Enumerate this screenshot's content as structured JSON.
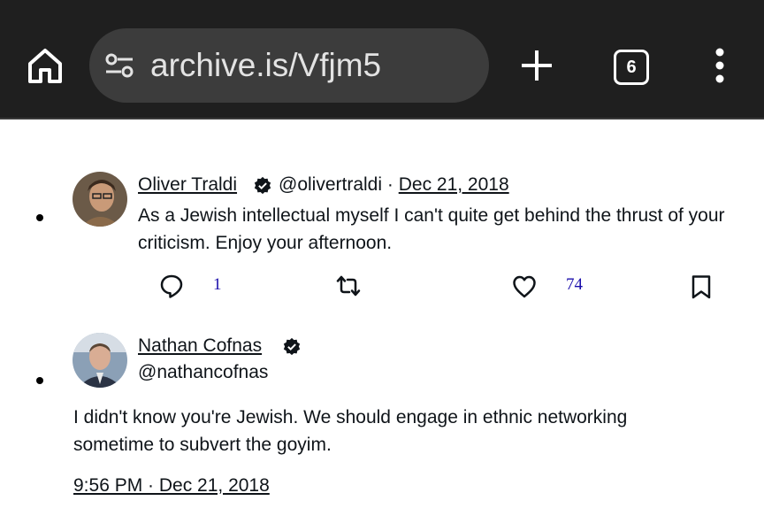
{
  "browser": {
    "url": "archive.is/Vfjm5",
    "tab_count": "6",
    "icons": [
      "home-icon",
      "site-settings-icon",
      "new-tab-icon",
      "tab-switcher-icon",
      "overflow-menu-icon"
    ],
    "bar_color": "#1f1f1f",
    "url_bg_color": "#3c3c3c"
  },
  "tweets": [
    {
      "author_name": "Oliver Traldi",
      "handle": "@olivertraldi",
      "separator": "·",
      "date": "Dec 21, 2018",
      "text": "As a Jewish intellectual myself I can't quite get behind the thrust of your criticism. Enjoy your afternoon.",
      "replies": "1",
      "likes": "74"
    },
    {
      "author_name": "Nathan Cofnas",
      "handle": "@nathancofnas",
      "text": "I didn't know you're Jewish. We should engage in ethnic networking sometime to subvert the goyim.",
      "timestamp": "9:56 PM · Dec 21, 2018"
    }
  ],
  "colors": {
    "link_count": "#1a0dab",
    "text": "#0f1419"
  }
}
